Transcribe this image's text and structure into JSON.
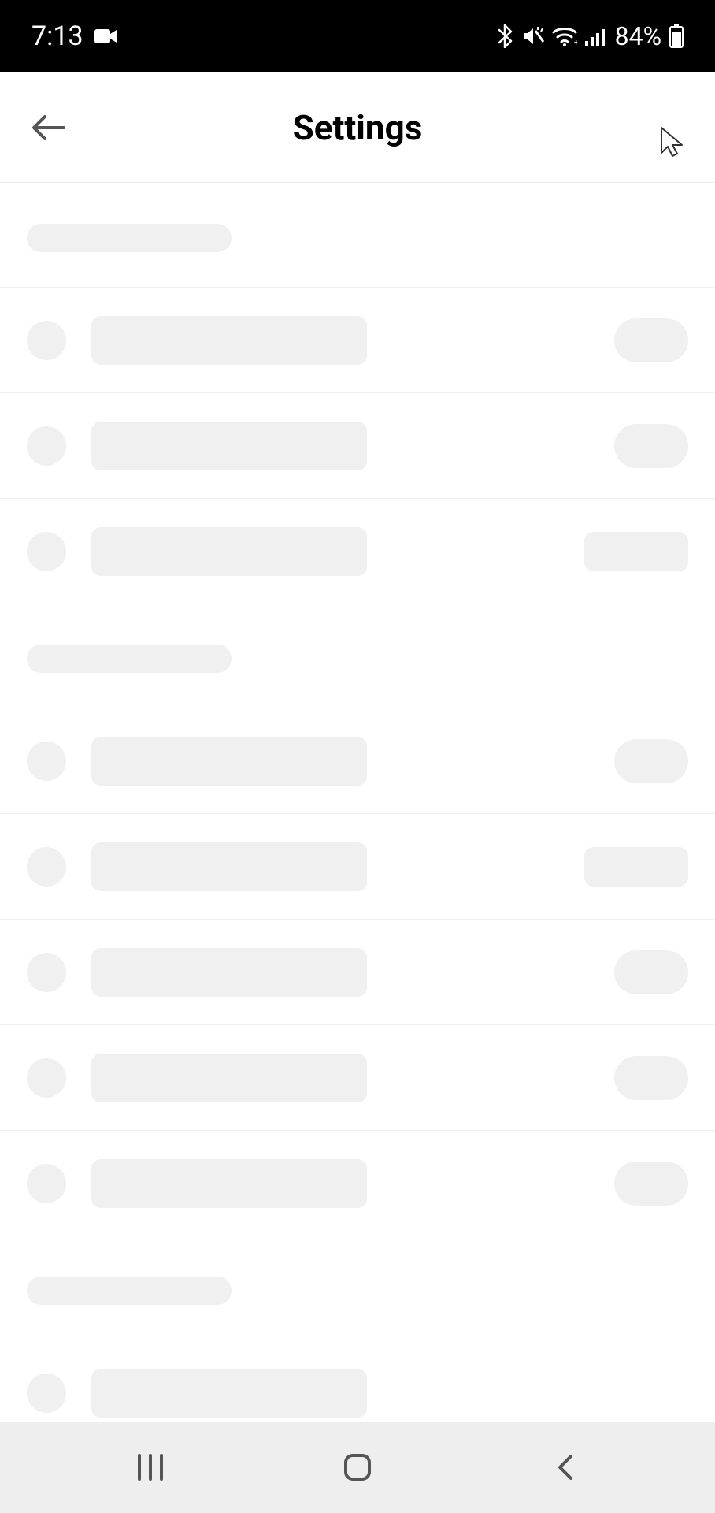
{
  "status_bar": {
    "time": "7:13",
    "battery_pct": "84%"
  },
  "header": {
    "title": "Settings"
  },
  "skeleton": {
    "sections": [
      {
        "rows": [
          {
            "trail": "pill"
          },
          {
            "trail": "pill"
          },
          {
            "trail": "rect"
          }
        ]
      },
      {
        "rows": [
          {
            "trail": "pill"
          },
          {
            "trail": "rect"
          },
          {
            "trail": "pill"
          },
          {
            "trail": "pill"
          },
          {
            "trail": "pill"
          }
        ]
      },
      {
        "rows": [
          {
            "trail": "none"
          }
        ]
      }
    ]
  }
}
